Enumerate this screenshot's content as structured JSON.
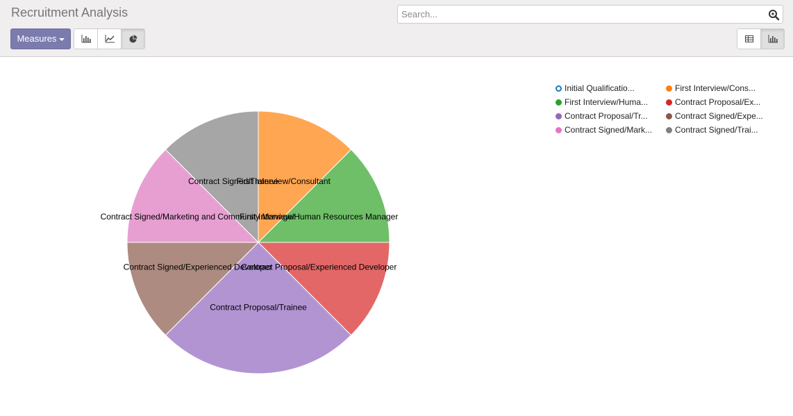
{
  "header": {
    "title": "Recruitment Analysis",
    "search_placeholder": "Search...",
    "measures_label": "Measures"
  },
  "view_buttons": [
    {
      "name": "bar-chart-icon",
      "active": false
    },
    {
      "name": "line-chart-icon",
      "active": false
    },
    {
      "name": "pie-chart-icon",
      "active": true
    }
  ],
  "view_switch": [
    {
      "name": "pivot-view-icon",
      "active": false
    },
    {
      "name": "graph-view-icon",
      "active": true
    }
  ],
  "chart_data": {
    "type": "pie",
    "slices": [
      {
        "label": "Initial Qualification",
        "legend": "Initial Qualificatio...",
        "value": 0,
        "color": "#ffffff",
        "stroke": "#1f77b4",
        "legend_color": "#1f77b4",
        "hollow": true
      },
      {
        "label": "First Interview/Consultant",
        "legend": "First Interview/Cons...",
        "value": 1,
        "color": "#ffa652",
        "legend_color": "#ff7f0e"
      },
      {
        "label": "First Interview/Human Resources Manager",
        "legend": "First Interview/Huma...",
        "value": 1,
        "color": "#6ebf67",
        "legend_color": "#2ca02c"
      },
      {
        "label": "Contract Proposal/Experienced Developer",
        "legend": "Contract Proposal/Ex...",
        "value": 1,
        "color": "#e36767",
        "legend_color": "#d62728"
      },
      {
        "label": "Contract Proposal/Trainee",
        "legend": "Contract Proposal/Tr...",
        "value": 2,
        "color": "#b294d3",
        "legend_color": "#9467bd"
      },
      {
        "label": "Contract Signed/Experienced Developer",
        "legend": "Contract Signed/Expe...",
        "value": 1,
        "color": "#ad8b80",
        "legend_color": "#8c564b"
      },
      {
        "label": "Contract Signed/Marketing and Community Manager",
        "legend": "Contract Signed/Mark...",
        "value": 1,
        "color": "#e79fd2",
        "legend_color": "#e377c2"
      },
      {
        "label": "Contract Signed/Trainee",
        "legend": "Contract Signed/Trai...",
        "value": 1,
        "color": "#a6a6a6",
        "legend_color": "#7f7f7f"
      }
    ]
  }
}
